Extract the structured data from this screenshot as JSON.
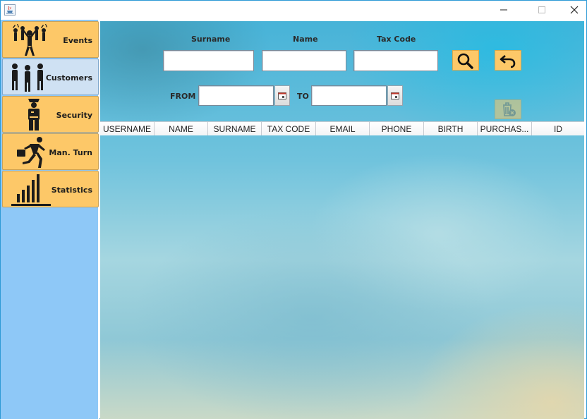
{
  "window": {
    "controls": {
      "minimize": "—",
      "maximize": "☐",
      "close": "✕"
    }
  },
  "sidebar": {
    "items": [
      {
        "label": "Events",
        "icon": "crowd-cheering-icon",
        "selected": false
      },
      {
        "label": "Customers",
        "icon": "people-group-icon",
        "selected": true
      },
      {
        "label": "Security",
        "icon": "security-guard-icon",
        "selected": false
      },
      {
        "label": "Man. Turn",
        "icon": "running-man-icon",
        "selected": false
      },
      {
        "label": "Statistics",
        "icon": "bar-chart-icon",
        "selected": false
      }
    ]
  },
  "search": {
    "surname_label": "Surname",
    "name_label": "Name",
    "taxcode_label": "Tax Code",
    "surname_value": "",
    "name_value": "",
    "taxcode_value": "",
    "from_label": "FROM",
    "to_label": "TO",
    "from_value": "",
    "to_value": ""
  },
  "actions": {
    "search_icon": "magnifier-icon",
    "back_icon": "undo-arrow-icon",
    "delete_icon": "trash-delete-icon",
    "delete_enabled": false
  },
  "table": {
    "columns": [
      "USERNAME",
      "NAME",
      "SURNAME",
      "TAX CODE",
      "EMAIL",
      "PHONE",
      "BIRTH",
      "PURCHAS...",
      "ID"
    ],
    "rows": []
  },
  "colors": {
    "nav_button": "#fdc868",
    "nav_selected": "#cfe1f3",
    "sidebar_bg": "#8ec8f7"
  }
}
